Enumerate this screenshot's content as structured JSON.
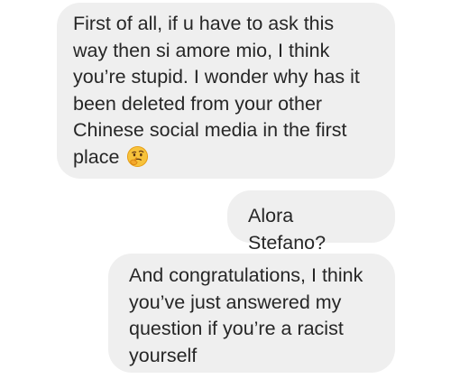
{
  "messages": [
    {
      "sender": "other",
      "lines": [
        "First of all, if u have to ask this",
        "way then si amore mio, I think",
        "you’re stupid. I wonder why has it",
        "been deleted from your other",
        "Chinese social media in the first",
        "place"
      ],
      "emoji": "thinking-face-emoji"
    },
    {
      "sender": "self",
      "lines": [
        "Alora Stefano?"
      ]
    },
    {
      "sender": "other",
      "lines": [
        "And congratulations, I think",
        "you’ve just answered my",
        "question if you’re a racist",
        "yourself"
      ]
    }
  ],
  "colors": {
    "bubble": "#efefef",
    "text": "#262626",
    "background": "#ffffff"
  }
}
